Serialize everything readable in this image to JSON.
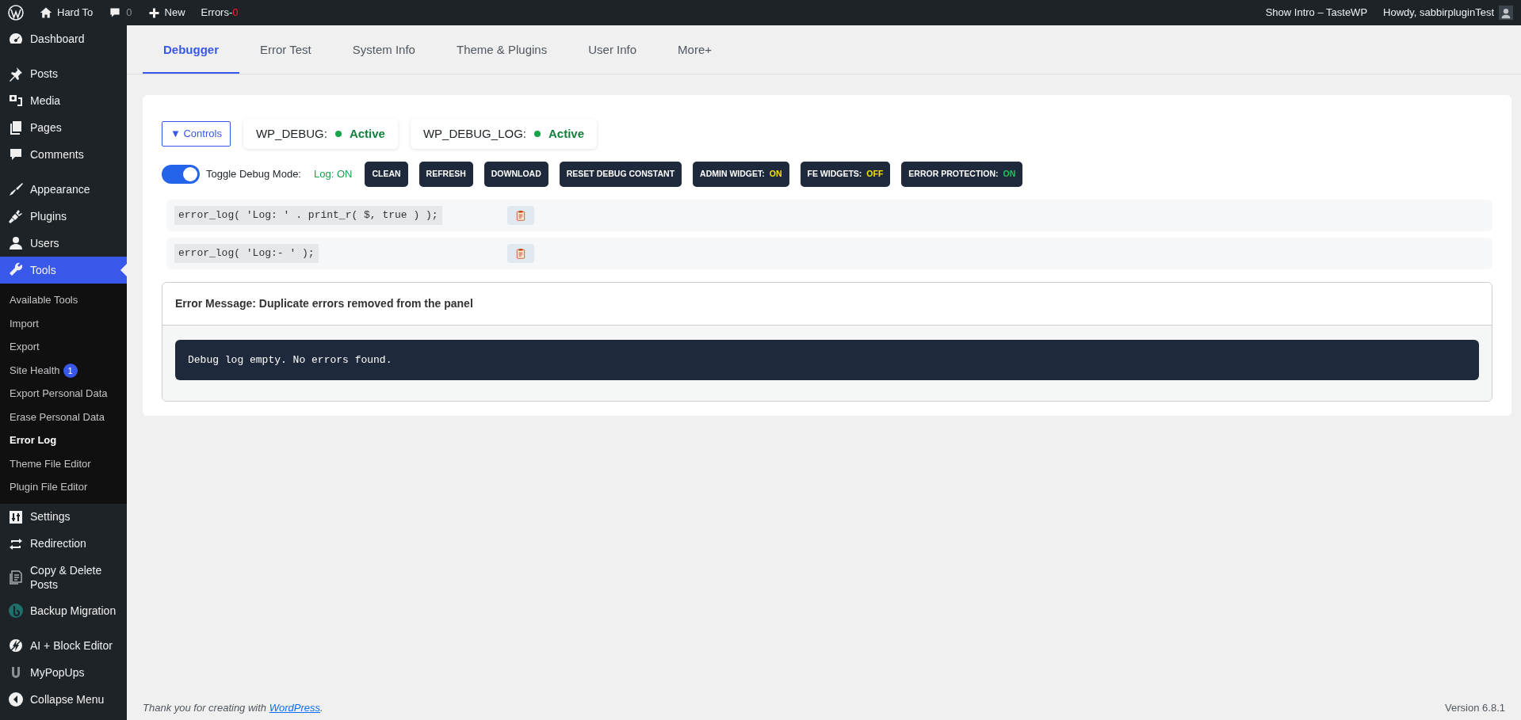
{
  "admin_bar": {
    "site": "Hard To",
    "comments": "0",
    "new": "New",
    "errors_label": "Errors-",
    "errors_count": "0",
    "intro": "Show Intro – TasteWP",
    "howdy": "Howdy, sabbirpluginTest"
  },
  "sidebar": {
    "groups": [
      [
        {
          "label": "Dashboard",
          "selected": false
        }
      ],
      [
        {
          "label": "Posts",
          "selected": false
        },
        {
          "label": "Media",
          "selected": false
        },
        {
          "label": "Pages",
          "selected": false
        },
        {
          "label": "Comments",
          "selected": false
        }
      ],
      [
        {
          "label": "Appearance",
          "selected": false
        },
        {
          "label": "Plugins",
          "selected": false
        },
        {
          "label": "Users",
          "selected": false
        },
        {
          "label": "Tools",
          "selected": true,
          "children": [
            {
              "label": "Available Tools",
              "selected": false
            },
            {
              "label": "Import",
              "selected": false
            },
            {
              "label": "Export",
              "selected": false
            },
            {
              "label": "Site Health",
              "selected": false,
              "badge": "1"
            },
            {
              "label": "Export Personal Data",
              "selected": false
            },
            {
              "label": "Erase Personal Data",
              "selected": false
            },
            {
              "label": "Error Log",
              "selected": true
            },
            {
              "label": "Theme File Editor",
              "selected": false
            },
            {
              "label": "Plugin File Editor",
              "selected": false
            }
          ]
        },
        {
          "label": "Settings",
          "selected": false
        },
        {
          "label": "Redirection",
          "selected": false
        },
        {
          "label": "Copy & Delete Posts",
          "selected": false
        },
        {
          "label": "Backup Migration",
          "selected": false
        }
      ],
      [
        {
          "label": "AI + Block Editor",
          "selected": false
        },
        {
          "label": "MyPopUps",
          "selected": false
        },
        {
          "label": "Collapse Menu",
          "selected": false
        }
      ]
    ]
  },
  "tabs": [
    {
      "label": "Debugger",
      "selected": true
    },
    {
      "label": "Error Test",
      "selected": false
    },
    {
      "label": "System Info",
      "selected": false
    },
    {
      "label": "Theme & Plugins",
      "selected": false
    },
    {
      "label": "User Info",
      "selected": false
    },
    {
      "label": "More+",
      "selected": false
    }
  ],
  "controls_button": "▼ Controls",
  "constants": [
    {
      "label": "WP_DEBUG:",
      "value": "Active",
      "active": true
    },
    {
      "label": "WP_DEBUG_LOG:",
      "value": "Active",
      "active": true
    }
  ],
  "toggle": {
    "label": "Toggle Debug Mode:",
    "on": true,
    "status": "Log: ON"
  },
  "actions": [
    {
      "label": "CLEAN"
    },
    {
      "label": "REFRESH"
    },
    {
      "label": "DOWNLOAD"
    },
    {
      "label": "RESET DEBUG CONSTANT"
    },
    {
      "label": "ADMIN WIDGET:",
      "state": "ON",
      "color": "#f5e10a"
    },
    {
      "label": "FE WIDGETS:",
      "state": "OFF",
      "color": "#f5e10a"
    },
    {
      "label": "ERROR PROTECTION:",
      "state": "ON",
      "color": "#22c55e"
    }
  ],
  "snippets": [
    "error_log( 'Log: ' . print_r( $, true ) );",
    "error_log( 'Log:- ' );"
  ],
  "panel": {
    "title": "Error Message: Duplicate errors removed from the panel",
    "message": "Debug log empty. No errors found."
  },
  "footer": {
    "text": "Thank you for creating with ",
    "link": "WordPress",
    "after": ".",
    "version": "Version 6.8.1"
  }
}
